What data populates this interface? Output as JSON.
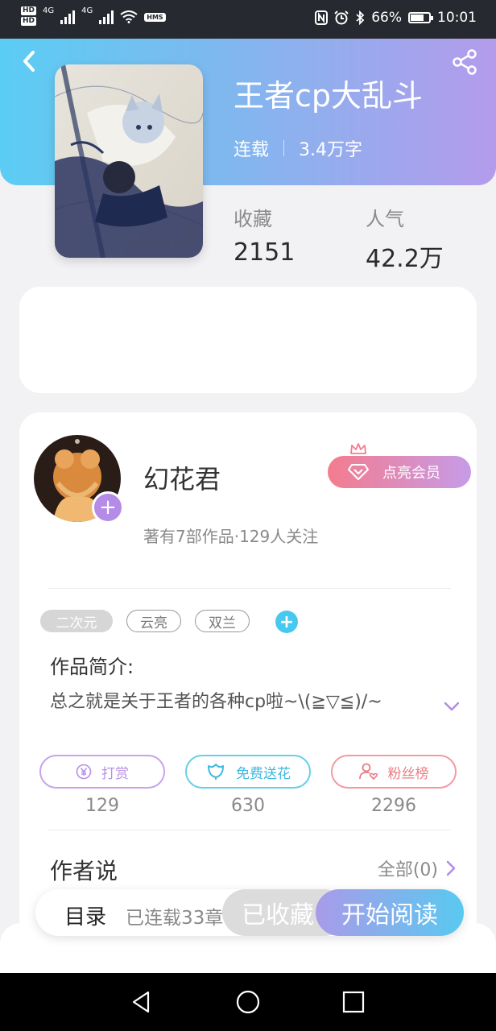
{
  "status_bar": {
    "hd1": "HD",
    "hd2": "HD",
    "net1": "4G",
    "net2": "4G",
    "hms": "HMS",
    "battery": "66%",
    "time": "10:01"
  },
  "book": {
    "title": "王者cp大乱斗",
    "status": "连载",
    "word_count": "3.4万字",
    "favorites_label": "收藏",
    "favorites_value": "2151",
    "popularity_label": "人气",
    "popularity_value": "42.2万"
  },
  "author": {
    "name": "幻花君",
    "summary": "著有7部作品·129人关注",
    "vip_button": "点亮会员"
  },
  "tags": [
    "二次元",
    "云亮",
    "双兰"
  ],
  "intro": {
    "title": "作品简介:",
    "text": "总之就是关于王者的各种cp啦~\\(≧▽≦)/~"
  },
  "actions": [
    {
      "label": "打赏",
      "count": "129"
    },
    {
      "label": "免费送花",
      "count": "630"
    },
    {
      "label": "粉丝榜",
      "count": "2296"
    }
  ],
  "author_says": {
    "title": "作者说",
    "see_all": "全部(0)"
  },
  "bottom_bar": {
    "toc": "目录",
    "toc_sub": "已连载33章",
    "collected": "已收藏",
    "start_reading": "开始阅读"
  },
  "colors": {
    "header_gradient_start": "#5bcdf4",
    "header_gradient_end": "#b49bec",
    "accent_cyan": "#47c8ee",
    "accent_purple": "#b48be6",
    "vip_pink": "#f37c8e"
  },
  "icons": [
    "back-icon",
    "share-icon",
    "plus-icon",
    "crown-icon",
    "diamond-icon",
    "yen-icon",
    "flower-icon",
    "fans-icon",
    "chevron-down-icon",
    "chevron-right-icon",
    "nav-back-icon",
    "nav-home-icon",
    "nav-recents-icon"
  ]
}
